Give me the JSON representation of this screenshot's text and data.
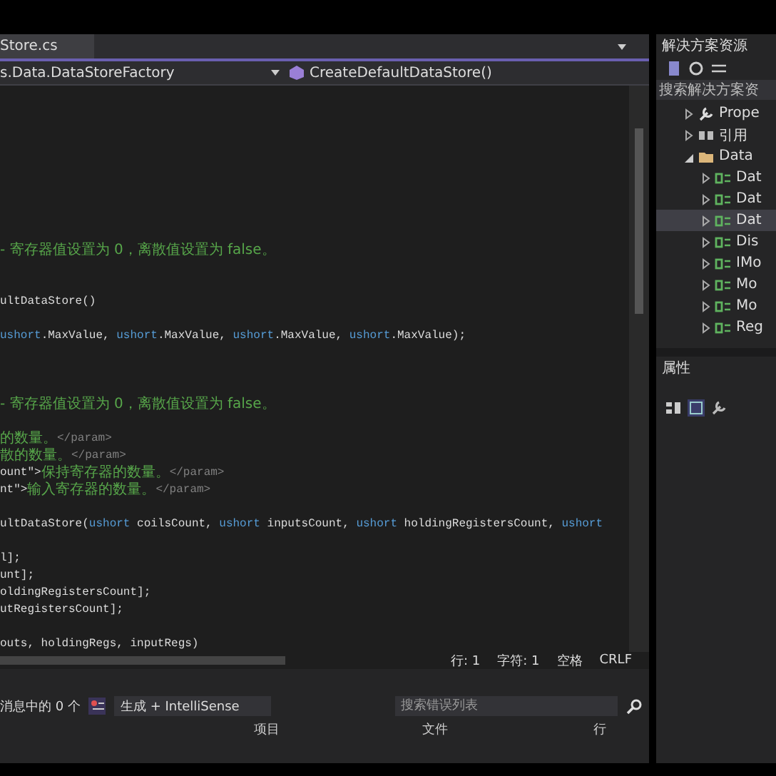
{
  "editor": {
    "tab": {
      "label": "Store.cs",
      "selected": true
    },
    "nav": {
      "class": "s.Data.DataStoreFactory",
      "member": "CreateDefaultDataStore()"
    },
    "lines": [
      {
        "kind": "blank"
      },
      {
        "kind": "blank"
      },
      {
        "kind": "blank"
      },
      {
        "kind": "blank"
      },
      {
        "kind": "blank"
      },
      {
        "kind": "blank"
      },
      {
        "kind": "blank"
      },
      {
        "kind": "blank"
      },
      {
        "kind": "blank"
      },
      {
        "kind": "code",
        "segments": [
          {
            "text": "- 寄存器值设置为 0，离散值设置为 false。",
            "kind": "comment"
          }
        ]
      },
      {
        "kind": "blank"
      },
      {
        "kind": "blank"
      },
      {
        "kind": "code",
        "segments": [
          {
            "text": "ultDataStore()",
            "kind": "plain"
          }
        ]
      },
      {
        "kind": "blank"
      },
      {
        "kind": "code",
        "segments": [
          {
            "text": "ushort",
            "kind": "keyword"
          },
          {
            "text": ".MaxValue, ",
            "kind": "plain"
          },
          {
            "text": "ushort",
            "kind": "keyword"
          },
          {
            "text": ".MaxValue, ",
            "kind": "plain"
          },
          {
            "text": "ushort",
            "kind": "keyword"
          },
          {
            "text": ".MaxValue, ",
            "kind": "plain"
          },
          {
            "text": "ushort",
            "kind": "keyword"
          },
          {
            "text": ".MaxValue);",
            "kind": "plain"
          }
        ]
      },
      {
        "kind": "blank"
      },
      {
        "kind": "blank"
      },
      {
        "kind": "blank"
      },
      {
        "kind": "code",
        "segments": [
          {
            "text": "- 寄存器值设置为 0，离散值设置为 false。",
            "kind": "comment"
          }
        ]
      },
      {
        "kind": "blank"
      },
      {
        "kind": "code",
        "segments": [
          {
            "text": "的数量。",
            "kind": "comment"
          },
          {
            "text": "</param>",
            "kind": "doctag"
          }
        ]
      },
      {
        "kind": "code",
        "segments": [
          {
            "text": "散的数量。",
            "kind": "comment"
          },
          {
            "text": "</param>",
            "kind": "doctag"
          }
        ]
      },
      {
        "kind": "code",
        "segments": [
          {
            "text": "ount\">",
            "kind": "plain"
          },
          {
            "text": "保持寄存器的数量。",
            "kind": "comment"
          },
          {
            "text": "</param>",
            "kind": "doctag"
          }
        ]
      },
      {
        "kind": "code",
        "segments": [
          {
            "text": "nt\">",
            "kind": "plain"
          },
          {
            "text": "输入寄存器的数量。",
            "kind": "comment"
          },
          {
            "text": "</param>",
            "kind": "doctag"
          }
        ]
      },
      {
        "kind": "blank"
      },
      {
        "kind": "code",
        "segments": [
          {
            "text": "ultDataStore(",
            "kind": "plain"
          },
          {
            "text": "ushort",
            "kind": "keyword"
          },
          {
            "text": " coilsCount, ",
            "kind": "plain"
          },
          {
            "text": "ushort",
            "kind": "keyword"
          },
          {
            "text": " inputsCount, ",
            "kind": "plain"
          },
          {
            "text": "ushort",
            "kind": "keyword"
          },
          {
            "text": " holdingRegistersCount, ",
            "kind": "plain"
          },
          {
            "text": "ushort",
            "kind": "keyword"
          }
        ]
      },
      {
        "kind": "blank"
      },
      {
        "kind": "code",
        "segments": [
          {
            "text": "l];",
            "kind": "plain"
          }
        ]
      },
      {
        "kind": "code",
        "segments": [
          {
            "text": "unt];",
            "kind": "plain"
          }
        ]
      },
      {
        "kind": "code",
        "segments": [
          {
            "text": "oldingRegistersCount];",
            "kind": "plain"
          }
        ]
      },
      {
        "kind": "code",
        "segments": [
          {
            "text": "utRegistersCount];",
            "kind": "plain"
          }
        ]
      },
      {
        "kind": "blank"
      },
      {
        "kind": "code",
        "segments": [
          {
            "text": "outs, holdingRegs, inputRegs)",
            "kind": "plain"
          }
        ]
      }
    ],
    "status": {
      "line": "行: 1",
      "char": "字符: 1",
      "spaces": "空格",
      "eol": "CRLF"
    }
  },
  "error_list": {
    "messages": "消息中的 0 个",
    "filter": "生成 + IntelliSense",
    "search": {
      "placeholder": "搜索错误列表"
    },
    "columns": [
      "项目",
      "文件",
      "行"
    ]
  },
  "solution_explorer": {
    "title": "解决方案资源",
    "search": {
      "placeholder": "搜索解决方案资"
    },
    "items": [
      {
        "label": "Prope",
        "kind": "properties",
        "expanded": false,
        "selected": false
      },
      {
        "label": "引用",
        "kind": "references",
        "expanded": false,
        "selected": false
      },
      {
        "label": "Data",
        "kind": "folder",
        "expanded": true,
        "selected": false,
        "children": [
          {
            "label": "Dat",
            "kind": "csharp",
            "expanded": false,
            "selected": false
          },
          {
            "label": "Dat",
            "kind": "csharp",
            "expanded": false,
            "selected": false
          },
          {
            "label": "Dat",
            "kind": "csharp",
            "expanded": false,
            "selected": true
          },
          {
            "label": "Dis",
            "kind": "csharp",
            "expanded": false,
            "selected": false
          },
          {
            "label": "IMo",
            "kind": "csharp",
            "expanded": false,
            "selected": false
          },
          {
            "label": "Mo",
            "kind": "csharp",
            "expanded": false,
            "selected": false
          },
          {
            "label": "Mo",
            "kind": "csharp",
            "expanded": false,
            "selected": false
          },
          {
            "label": "Reg",
            "kind": "csharp",
            "expanded": false,
            "selected": false
          }
        ]
      }
    ]
  },
  "properties": {
    "title": "属性"
  }
}
